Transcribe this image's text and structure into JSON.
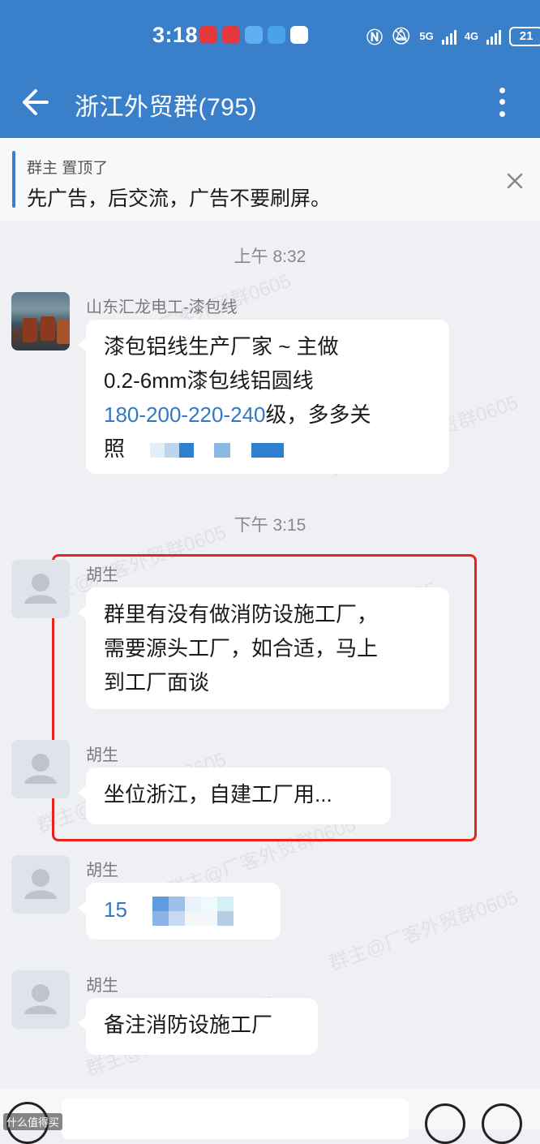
{
  "status_bar": {
    "time": "3:18",
    "network1": "5G",
    "network2": "4G",
    "battery": "21"
  },
  "header": {
    "title": "浙江外贸群(795)"
  },
  "pinned": {
    "meta": "群主 置顶了",
    "text": "先广告，后交流，广告不要刷屏。"
  },
  "times": {
    "t1": "上午 8:32",
    "t2": "下午 3:15"
  },
  "messages": [
    {
      "sender": "山东汇龙电工-漆包线",
      "line1": "漆包铝线生产厂家 ~ 主做",
      "line2": "0.2-6mm漆包线铝圆线",
      "line3_link": "180-200-220-240",
      "line3_rest": "级，多多关",
      "line4": "照"
    },
    {
      "sender": "胡生",
      "line1": "群里有没有做消防设施工厂，",
      "line2": "需要源头工厂，如合适，马上",
      "line3": "到工厂面谈"
    },
    {
      "sender": "胡生",
      "text": "坐位浙江，自建工厂用..."
    },
    {
      "sender": "胡生",
      "text": "15"
    },
    {
      "sender": "胡生",
      "text": "备注消防设施工厂"
    }
  ],
  "watermark_text": "群主@厂客外贸群0605",
  "footer": {
    "brand": "什么值得买"
  },
  "colors": {
    "header_bg": "#3a7fc9",
    "link": "#3278c4",
    "highlight_box": "#e8231b",
    "chat_bg": "#eef0f4"
  }
}
